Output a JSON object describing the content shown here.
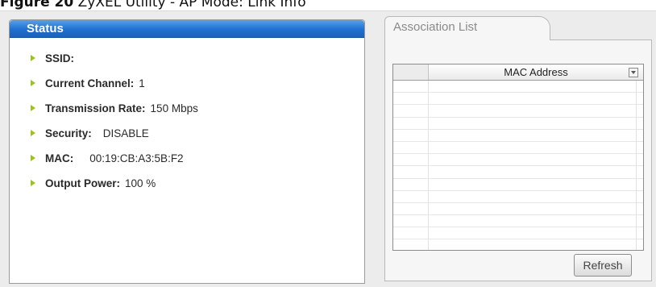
{
  "caption": {
    "figure": "Figure 20",
    "text": "ZyXEL Utility - AP Mode: Link Info"
  },
  "status": {
    "title": "Status",
    "rows": [
      {
        "label": "SSID:",
        "value": ""
      },
      {
        "label": "Current Channel:",
        "value": "1"
      },
      {
        "label": "Transmission Rate:",
        "value": "150 Mbps"
      },
      {
        "label": "Security:",
        "value": "DISABLE"
      },
      {
        "label": "MAC:",
        "value": "00:19:CB:A3:5B:F2"
      },
      {
        "label": "Output Power:",
        "value": "100 %"
      }
    ]
  },
  "association": {
    "tab_label": "Association List",
    "column_header": "MAC Address",
    "refresh_label": "Refresh"
  },
  "colors": {
    "header_blue": "#1f6fd0",
    "bullet_green": "#9cc21d"
  }
}
